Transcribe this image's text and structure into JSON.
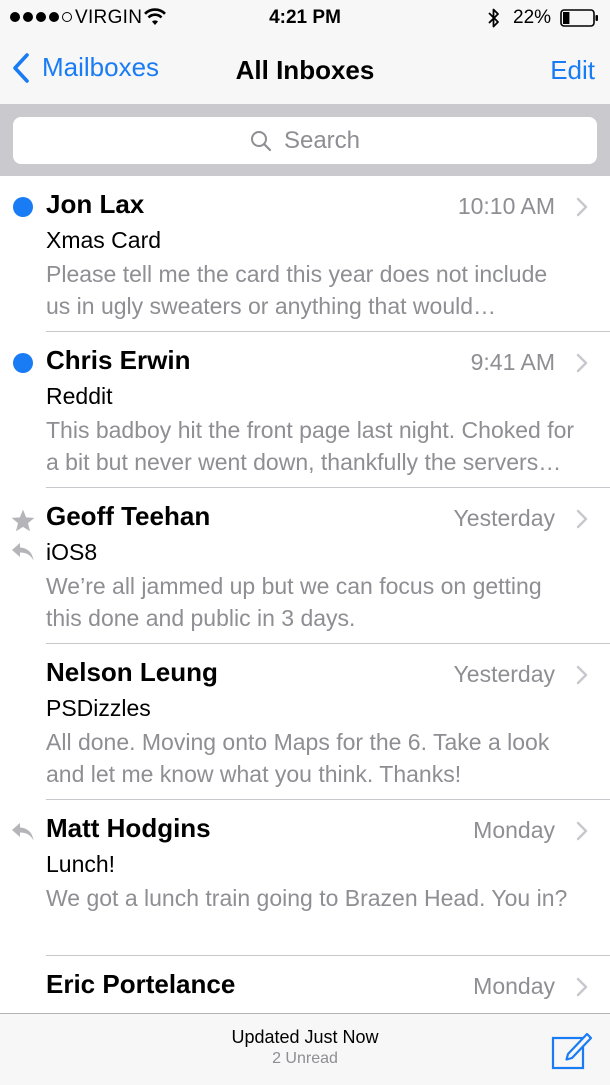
{
  "status_bar": {
    "carrier": "VIRGIN",
    "time": "4:21 PM",
    "battery_pct": "22%",
    "battery_level": 0.22,
    "signal_bars_filled": 4,
    "signal_bars_total": 5
  },
  "nav": {
    "back_label": "Mailboxes",
    "title": "All Inboxes",
    "edit_label": "Edit"
  },
  "search": {
    "placeholder": "Search"
  },
  "messages": [
    {
      "sender": "Jon Lax",
      "date": "10:10 AM",
      "subject": "Xmas Card",
      "preview": "Please tell me the card this year does not include us in ugly sweaters or anything that would embarrass us.",
      "unread": true,
      "flagged": false,
      "replied": false
    },
    {
      "sender": "Chris Erwin",
      "date": "9:41 AM",
      "subject": "Reddit",
      "preview": "This badboy hit the front page last night. Choked for a bit but never went down, thankfully the servers held up.",
      "unread": true,
      "flagged": false,
      "replied": false
    },
    {
      "sender": "Geoff Teehan",
      "date": "Yesterday",
      "subject": "iOS8",
      "preview": "We’re all jammed up but we can focus on getting this done and public in 3 days.",
      "unread": false,
      "flagged": true,
      "replied": true
    },
    {
      "sender": "Nelson Leung",
      "date": "Yesterday",
      "subject": "PSDizzles",
      "preview": "All done. Moving onto Maps for the 6. Take a look and let me know what you think. Thanks!",
      "unread": false,
      "flagged": false,
      "replied": false
    },
    {
      "sender": "Matt Hodgins",
      "date": "Monday",
      "subject": "Lunch!",
      "preview": "We got a lunch train going to Brazen Head. You in?",
      "unread": false,
      "flagged": false,
      "replied": true
    },
    {
      "sender": "Eric Portelance",
      "date": "Monday",
      "subject": "",
      "preview": "",
      "unread": false,
      "flagged": false,
      "replied": false
    }
  ],
  "toolbar": {
    "status": "Updated Just Now",
    "unread_count": "2 Unread"
  },
  "colors": {
    "accent": "#1a7cf5",
    "secondary_text": "#8e8e93",
    "bar_bg": "#f7f7f7",
    "search_bg": "#c9c9ce"
  }
}
